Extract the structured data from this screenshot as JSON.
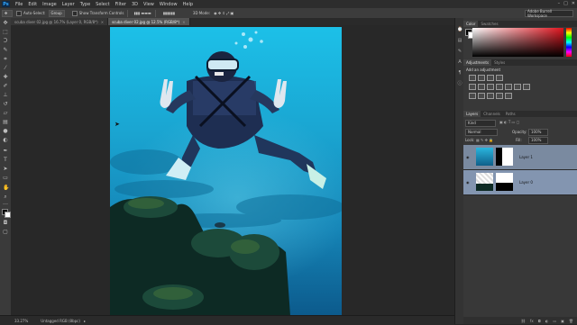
{
  "menubar": {
    "logo": "Ps",
    "items": [
      "File",
      "Edit",
      "Image",
      "Layer",
      "Type",
      "Select",
      "Filter",
      "3D",
      "View",
      "Window",
      "Help"
    ],
    "window_controls": [
      "–",
      "□",
      "✕"
    ]
  },
  "options": {
    "auto_select_label": "Auto-Select:",
    "auto_select_value": "Group",
    "show_transform_label": "Show Transform Controls",
    "mode_label": "3D Mode:",
    "workspace": "Adobe Burrell Workspace"
  },
  "tabs": [
    {
      "label": "scuba diver 02.jpg @ 16.7% (Layer 0, RGB/8*)",
      "active": false
    },
    {
      "label": "scuba diver 02.jpg @ 12.5% (RGB/8*)",
      "active": true
    }
  ],
  "status": {
    "zoom": "33.27%",
    "doc_info": "Untagged RGB (8bpc)"
  },
  "panels": {
    "color_tabs": [
      "Color",
      "Swatches"
    ],
    "adjustments_tabs": [
      "Adjustments",
      "Styles"
    ],
    "adjustments_heading": "Add an adjustment",
    "layers_tabs": [
      "Layers",
      "Channels",
      "Paths"
    ],
    "kind_label": "Kind",
    "blend_mode": "Normal",
    "opacity_label": "Opacity:",
    "opacity_value": "100%",
    "lock_label": "Lock:",
    "fill_label": "Fill:",
    "fill_value": "100%",
    "layers": [
      {
        "name": "Layer 1",
        "selected": false
      },
      {
        "name": "Layer 0",
        "selected": true
      }
    ]
  },
  "colors": {
    "water_top": "#1fb0d8",
    "water_bottom": "#0f5f8a",
    "color_picker_red": "#e0141e"
  }
}
